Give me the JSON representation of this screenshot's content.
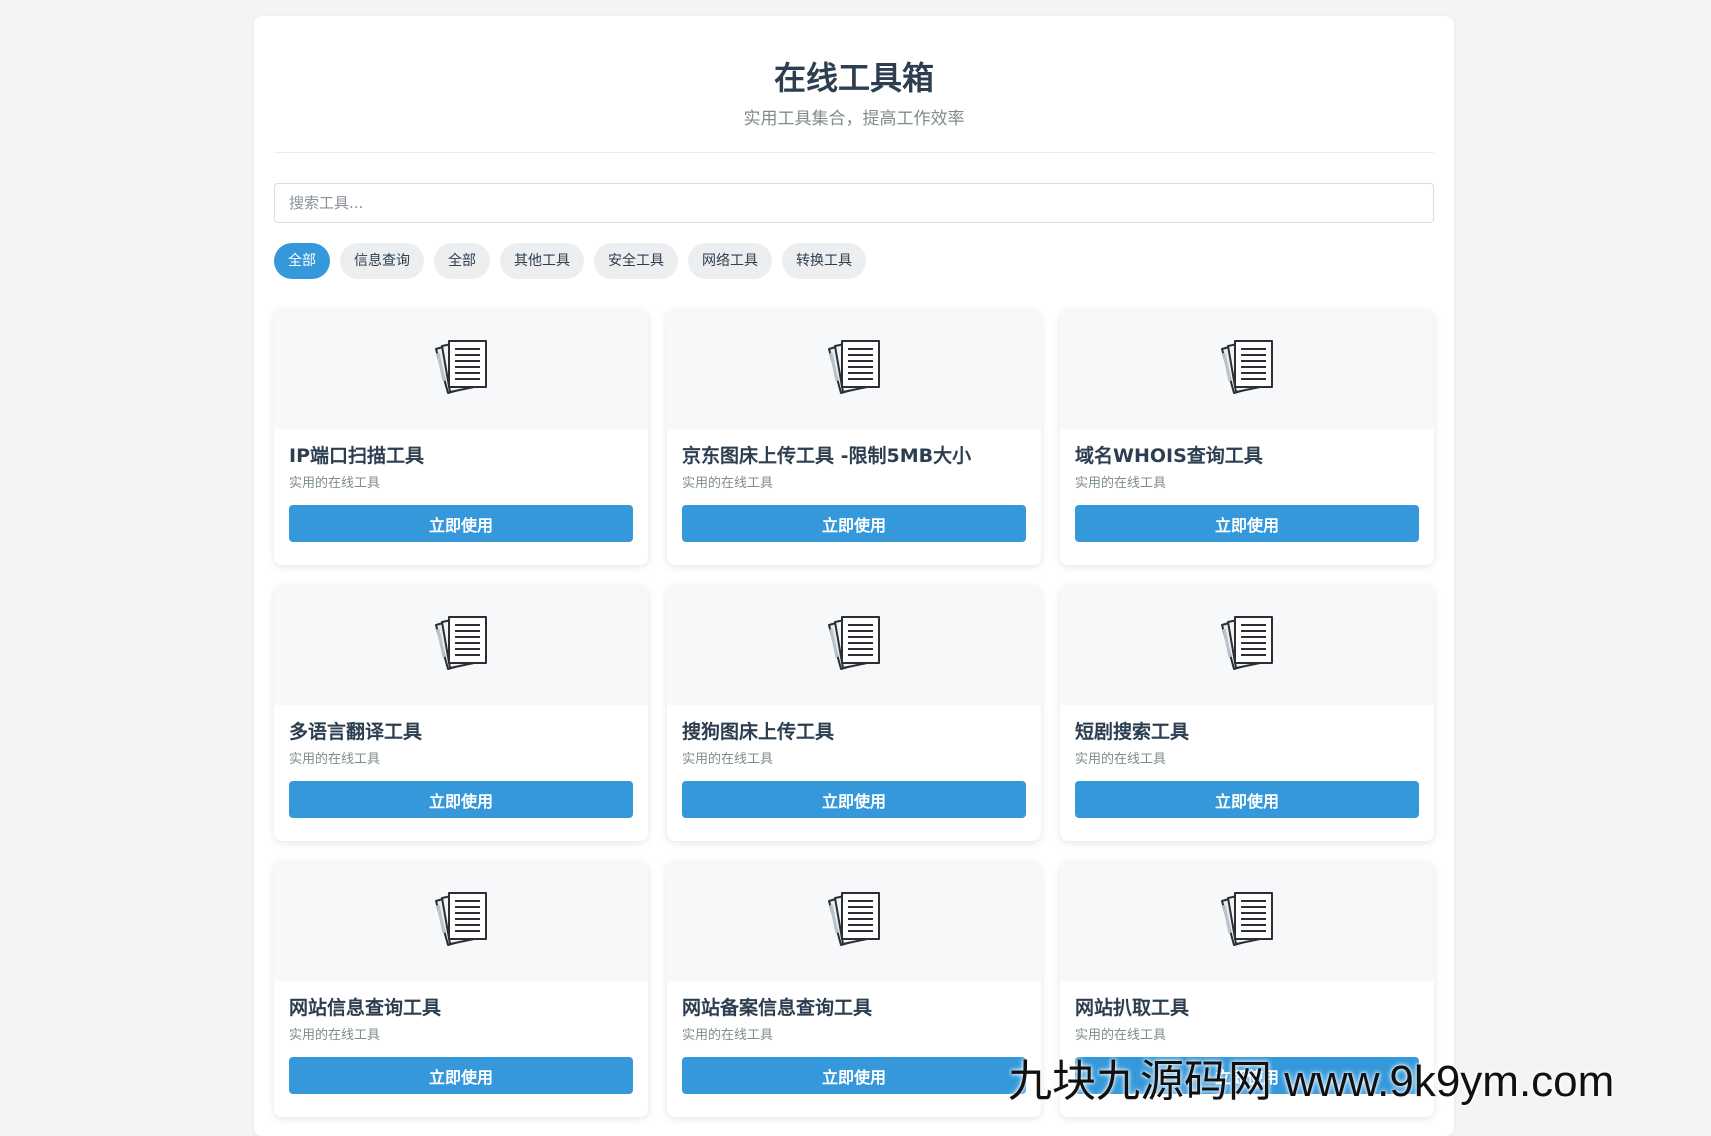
{
  "header": {
    "title": "在线工具箱",
    "subtitle": "实用工具集合，提高工作效率"
  },
  "search": {
    "placeholder": "搜索工具...",
    "value": ""
  },
  "filters": [
    {
      "label": "全部",
      "active": true
    },
    {
      "label": "信息查询",
      "active": false
    },
    {
      "label": "全部",
      "active": false
    },
    {
      "label": "其他工具",
      "active": false
    },
    {
      "label": "安全工具",
      "active": false
    },
    {
      "label": "网络工具",
      "active": false
    },
    {
      "label": "转换工具",
      "active": false
    }
  ],
  "tools": [
    {
      "title": "IP端口扫描工具",
      "desc": "实用的在线工具",
      "button": "立即使用",
      "icon": "documents-icon"
    },
    {
      "title": "京东图床上传工具 -限制5MB大小",
      "desc": "实用的在线工具",
      "button": "立即使用",
      "icon": "documents-icon"
    },
    {
      "title": "域名WHOIS查询工具",
      "desc": "实用的在线工具",
      "button": "立即使用",
      "icon": "documents-icon"
    },
    {
      "title": "多语言翻译工具",
      "desc": "实用的在线工具",
      "button": "立即使用",
      "icon": "documents-icon"
    },
    {
      "title": "搜狗图床上传工具",
      "desc": "实用的在线工具",
      "button": "立即使用",
      "icon": "documents-icon"
    },
    {
      "title": "短剧搜索工具",
      "desc": "实用的在线工具",
      "button": "立即使用",
      "icon": "documents-icon"
    },
    {
      "title": "网站信息查询工具",
      "desc": "实用的在线工具",
      "button": "立即使用",
      "icon": "documents-icon"
    },
    {
      "title": "网站备案信息查询工具",
      "desc": "实用的在线工具",
      "button": "立即使用",
      "icon": "documents-icon"
    },
    {
      "title": "网站扒取工具",
      "desc": "实用的在线工具",
      "button": "立即使用",
      "icon": "documents-icon"
    }
  ],
  "watermark": "九块九源码网 www.9k9ym.com",
  "colors": {
    "accent": "#3498db",
    "title": "#2c3e50",
    "muted": "#7f8c8d",
    "background": "#f3f4f6"
  }
}
